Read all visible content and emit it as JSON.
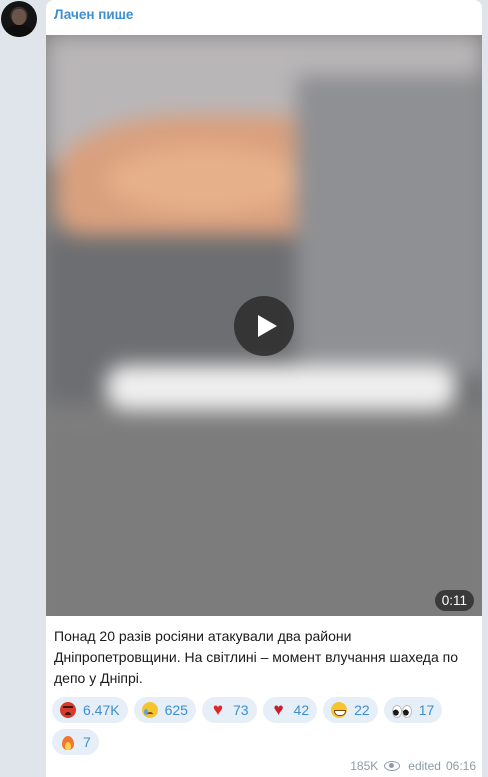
{
  "post": {
    "author": "Лачен пише",
    "video": {
      "duration": "0:11"
    },
    "caption": "Понад 20 разів росіяни атакували два райони\nДніпропетровщини. На світлині – момент влучання шахеда по\nдепо у Дніпрі.",
    "reactions": [
      {
        "emoji": "angry-face-icon",
        "count": "6.47K"
      },
      {
        "emoji": "crying-face-icon",
        "count": "625"
      },
      {
        "emoji": "red-heart-icon",
        "count": "73"
      },
      {
        "emoji": "broken-heart-icon",
        "count": "42"
      },
      {
        "emoji": "grinning-face-icon",
        "count": "22"
      },
      {
        "emoji": "eyes-icon",
        "count": "17"
      },
      {
        "emoji": "fire-icon",
        "count": "7"
      }
    ],
    "views": "185K",
    "edited_label": "edited",
    "time": "06:16"
  },
  "colors": {
    "accent": "#3d8fcf",
    "bubble": "#ffffff",
    "background": "#dfe5ea",
    "reaction_chip": "#e6eef8",
    "meta_text": "#8d9ba8"
  }
}
